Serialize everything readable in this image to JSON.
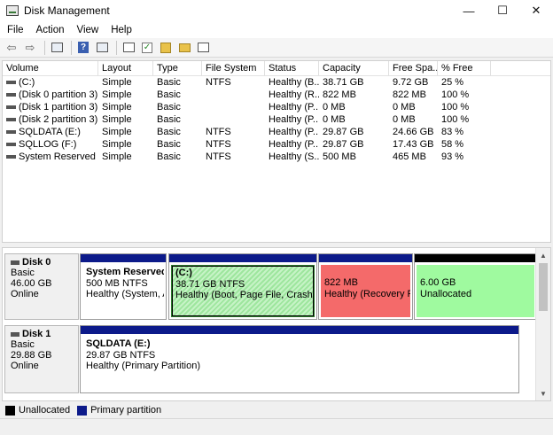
{
  "window": {
    "title": "Disk Management",
    "controls": {
      "minimize": "—",
      "maximize": "☐",
      "close": "✕"
    }
  },
  "menu": [
    "File",
    "Action",
    "View",
    "Help"
  ],
  "toolbar": {
    "icons": [
      "back-arrow-icon",
      "forward-arrow-icon",
      "console-tree-icon",
      "help-icon",
      "properties-icon",
      "rescan-icon",
      "check-icon",
      "up-folder-icon",
      "export-list-icon"
    ]
  },
  "volume_table": {
    "columns": [
      "Volume",
      "Layout",
      "Type",
      "File System",
      "Status",
      "Capacity",
      "Free Spa...",
      "% Free"
    ],
    "rows": [
      [
        "(C:)",
        "Simple",
        "Basic",
        "NTFS",
        "Healthy (B...",
        "38.71 GB",
        "9.72 GB",
        "25 %"
      ],
      [
        "(Disk 0 partition 3)",
        "Simple",
        "Basic",
        "",
        "Healthy (R...",
        "822 MB",
        "822 MB",
        "100 %"
      ],
      [
        "(Disk 1 partition 3)",
        "Simple",
        "Basic",
        "",
        "Healthy (P...",
        "0 MB",
        "0 MB",
        "100 %"
      ],
      [
        "(Disk 2 partition 3)",
        "Simple",
        "Basic",
        "",
        "Healthy (P...",
        "0 MB",
        "0 MB",
        "100 %"
      ],
      [
        "SQLDATA (E:)",
        "Simple",
        "Basic",
        "NTFS",
        "Healthy (P...",
        "29.87 GB",
        "24.66 GB",
        "83 %"
      ],
      [
        "SQLLOG (F:)",
        "Simple",
        "Basic",
        "NTFS",
        "Healthy (P...",
        "29.87 GB",
        "17.43 GB",
        "58 %"
      ],
      [
        "System Reserved",
        "Simple",
        "Basic",
        "NTFS",
        "Healthy (S...",
        "500 MB",
        "465 MB",
        "93 %"
      ]
    ]
  },
  "disks": [
    {
      "name": "Disk 0",
      "type": "Basic",
      "size": "46.00 GB",
      "state": "Online",
      "partitions": [
        {
          "name": "System Reserved",
          "size": "500 MB NTFS",
          "status": "Healthy (System, Ac"
        },
        {
          "name": "(C:)",
          "size": "38.71 GB NTFS",
          "status": "Healthy (Boot, Page File, Crash Dum"
        },
        {
          "name": "",
          "size": "822 MB",
          "status": "Healthy (Recovery Pa"
        },
        {
          "name": "",
          "size": "6.00 GB",
          "status": "Unallocated"
        }
      ]
    },
    {
      "name": "Disk 1",
      "type": "Basic",
      "size": "29.88 GB",
      "state": "Online",
      "partitions": [
        {
          "name": "SQLDATA  (E:)",
          "size": "29.87 GB NTFS",
          "status": "Healthy (Primary Partition)"
        }
      ]
    }
  ],
  "legend": [
    {
      "label": "Unallocated",
      "color": "#000000"
    },
    {
      "label": "Primary partition",
      "color": "#0c1a8a"
    }
  ]
}
